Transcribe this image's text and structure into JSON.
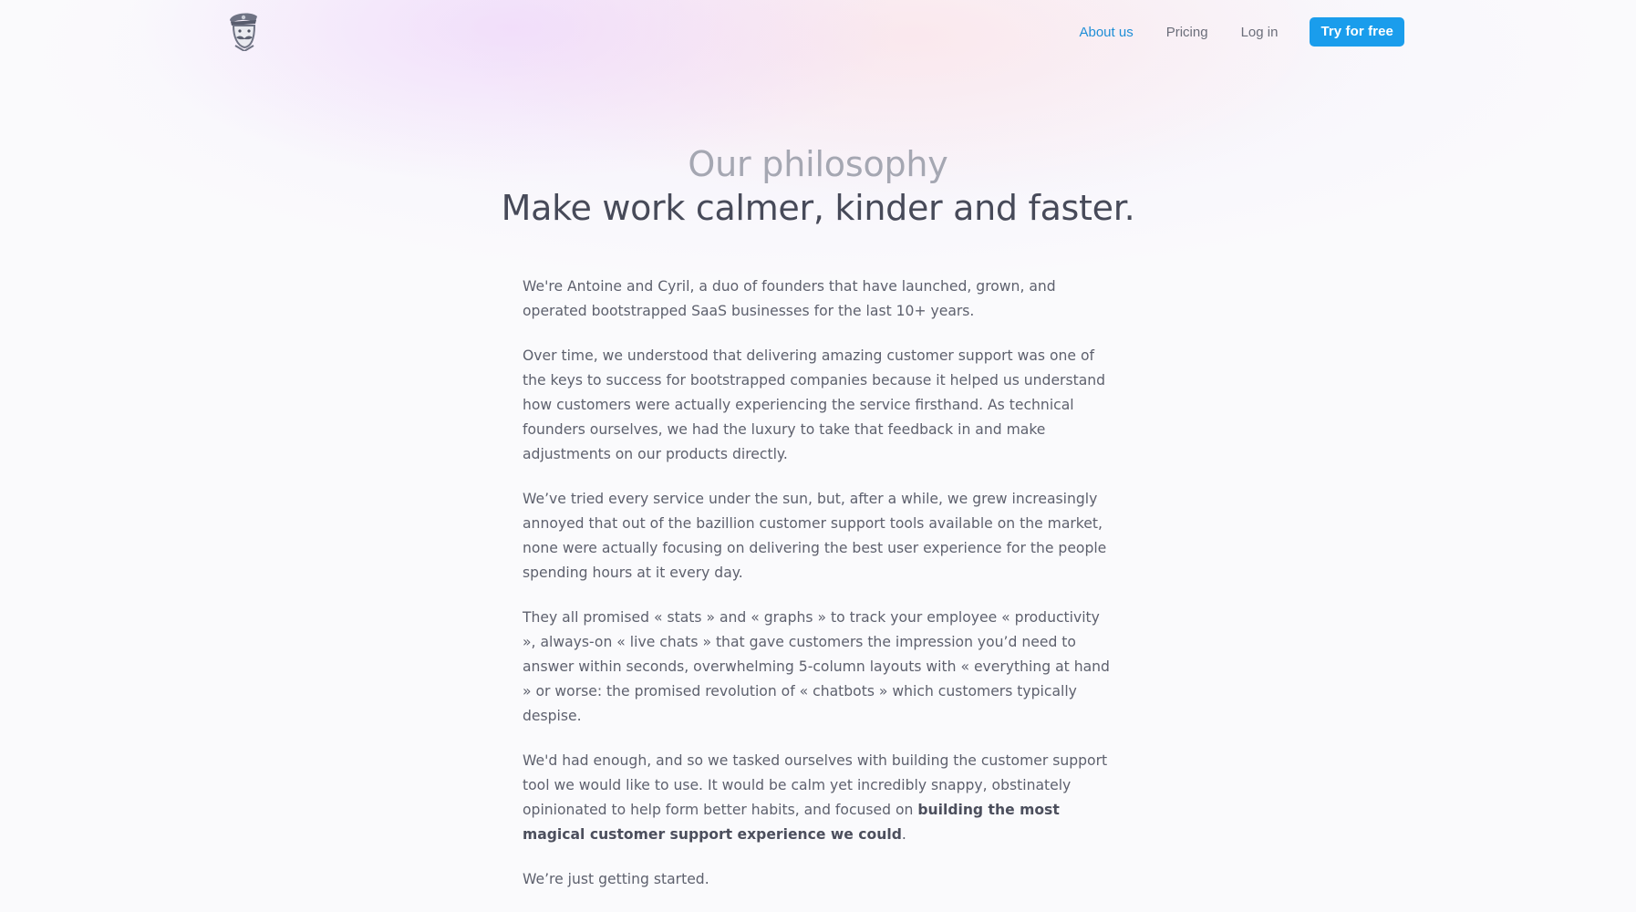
{
  "nav": {
    "logo_label": "Crisp mascot logo",
    "about": "About us",
    "pricing": "Pricing",
    "login": "Log in",
    "cta": "Try for free",
    "active_color": "#1f8ed6",
    "cta_color": "#1a9dec"
  },
  "hero": {
    "eyebrow": "Our philosophy",
    "title": "Make work calmer, kinder and faster."
  },
  "body": {
    "p1": "We're Antoine and Cyril, a duo of founders that have launched, grown, and operated bootstrapped SaaS businesses for the last 10+ years.",
    "p2": "Over time, we understood that delivering amazing customer support was one of the keys to success for bootstrapped companies because it helped us understand how customers were actually experiencing the service firsthand. As technical founders ourselves, we had the luxury to take that feedback in and make adjustments on our products directly.",
    "p3": "We’ve tried every service under the sun, but, after a while, we grew increasingly annoyed that out of the bazillion customer support tools available on the market, none were actually focusing on delivering the best user experience for the people spending hours at it every day.",
    "p4": "They all promised « stats » and « graphs » to track your employee « productivity », always-on « live chats » that gave customers the impression you’d need to answer within seconds, overwhelming 5-column layouts with « everything at hand » or worse: the promised revolution of « chatbots » which customers typically despise.",
    "p5_start": "We'd had enough, and so we tasked ourselves with building the customer support tool we would like to use. It would be calm yet incredibly snappy, obstinately opinionated to help form better habits, and focused on ",
    "p5_bold": "building the most magical customer support experience we could",
    "p5_end": ".",
    "p6": "We’re just getting started."
  }
}
